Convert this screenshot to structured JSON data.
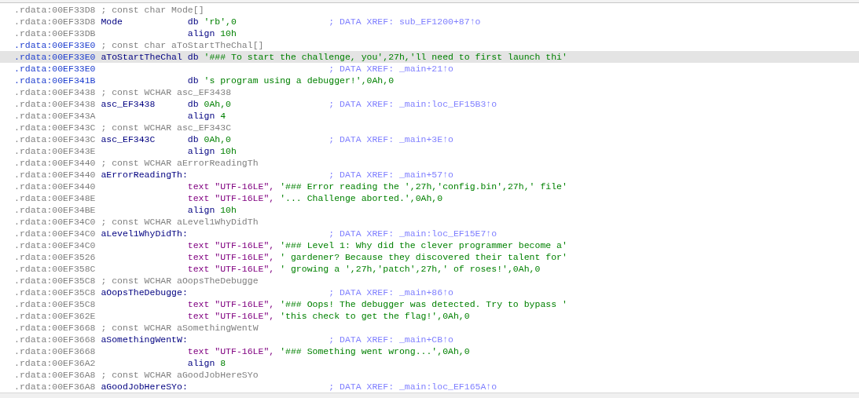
{
  "rows": [
    {
      "kind": "comment",
      "address": ".rdata:00EF33D8",
      "focused": false,
      "selected": false,
      "comment": "; const char Mode[]"
    },
    {
      "kind": "db",
      "address": ".rdata:00EF33D8",
      "focused": false,
      "selected": false,
      "label": "Mode",
      "mnemonic": "db",
      "operands": "'rb',0",
      "xref": "; DATA XREF: sub_EF1200+87↑o"
    },
    {
      "kind": "align",
      "address": ".rdata:00EF33DB",
      "focused": false,
      "selected": false,
      "mnemonic": "align",
      "operands": "10h"
    },
    {
      "kind": "comment",
      "address": ".rdata:00EF33E0",
      "focused": true,
      "selected": false,
      "comment": "; const char aToStartTheChal[]"
    },
    {
      "kind": "db",
      "address": ".rdata:00EF33E0",
      "focused": true,
      "selected": true,
      "label": "aToStartTheChal",
      "mnemonic": "db",
      "operands": "'### To start the challenge, you',27h,'ll need to first launch thi'"
    },
    {
      "kind": "xref",
      "address": ".rdata:00EF33E0",
      "focused": true,
      "selected": false,
      "xref": "; DATA XREF: _main+21↑o"
    },
    {
      "kind": "db",
      "address": ".rdata:00EF341B",
      "focused": true,
      "selected": false,
      "mnemonic": "db",
      "operands": "'s program using a debugger!',0Ah,0"
    },
    {
      "kind": "comment",
      "address": ".rdata:00EF3438",
      "focused": false,
      "selected": false,
      "comment": "; const WCHAR asc_EF3438"
    },
    {
      "kind": "db",
      "address": ".rdata:00EF3438",
      "focused": false,
      "selected": false,
      "label": "asc_EF3438",
      "mnemonic": "db",
      "operands": "0Ah,0",
      "xref": "; DATA XREF: _main:loc_EF15B3↑o"
    },
    {
      "kind": "align",
      "address": ".rdata:00EF343A",
      "focused": false,
      "selected": false,
      "mnemonic": "align",
      "operands": "4"
    },
    {
      "kind": "comment",
      "address": ".rdata:00EF343C",
      "focused": false,
      "selected": false,
      "comment": "; const WCHAR asc_EF343C"
    },
    {
      "kind": "db",
      "address": ".rdata:00EF343C",
      "focused": false,
      "selected": false,
      "label": "asc_EF343C",
      "mnemonic": "db",
      "operands": "0Ah,0",
      "xref": "; DATA XREF: _main+3E↑o"
    },
    {
      "kind": "align",
      "address": ".rdata:00EF343E",
      "focused": false,
      "selected": false,
      "mnemonic": "align",
      "operands": "10h"
    },
    {
      "kind": "comment",
      "address": ".rdata:00EF3440",
      "focused": false,
      "selected": false,
      "comment": "; const WCHAR aErrorReadingTh"
    },
    {
      "kind": "label",
      "address": ".rdata:00EF3440",
      "focused": false,
      "selected": false,
      "label": "aErrorReadingTh:",
      "xref": "; DATA XREF: _main+57↑o"
    },
    {
      "kind": "text",
      "address": ".rdata:00EF3440",
      "focused": false,
      "selected": false,
      "mnemonic": "text",
      "encoding": "\"UTF-16LE\",",
      "operands": "'### Error reading the ',27h,'config.bin',27h,' file'"
    },
    {
      "kind": "text",
      "address": ".rdata:00EF348E",
      "focused": false,
      "selected": false,
      "mnemonic": "text",
      "encoding": "\"UTF-16LE\",",
      "operands": "'... Challenge aborted.',0Ah,0"
    },
    {
      "kind": "align",
      "address": ".rdata:00EF34BE",
      "focused": false,
      "selected": false,
      "mnemonic": "align",
      "operands": "10h"
    },
    {
      "kind": "comment",
      "address": ".rdata:00EF34C0",
      "focused": false,
      "selected": false,
      "comment": "; const WCHAR aLevel1WhyDidTh"
    },
    {
      "kind": "label",
      "address": ".rdata:00EF34C0",
      "focused": false,
      "selected": false,
      "label": "aLevel1WhyDidTh:",
      "xref": "; DATA XREF: _main:loc_EF15E7↑o"
    },
    {
      "kind": "text",
      "address": ".rdata:00EF34C0",
      "focused": false,
      "selected": false,
      "mnemonic": "text",
      "encoding": "\"UTF-16LE\",",
      "operands": "'### Level 1: Why did the clever programmer become a'"
    },
    {
      "kind": "text",
      "address": ".rdata:00EF3526",
      "focused": false,
      "selected": false,
      "mnemonic": "text",
      "encoding": "\"UTF-16LE\",",
      "operands": "' gardener? Because they discovered their talent for'"
    },
    {
      "kind": "text",
      "address": ".rdata:00EF358C",
      "focused": false,
      "selected": false,
      "mnemonic": "text",
      "encoding": "\"UTF-16LE\",",
      "operands": "' growing a ',27h,'patch',27h,' of roses!',0Ah,0"
    },
    {
      "kind": "comment",
      "address": ".rdata:00EF35C8",
      "focused": false,
      "selected": false,
      "comment": "; const WCHAR aOopsTheDebugge"
    },
    {
      "kind": "label",
      "address": ".rdata:00EF35C8",
      "focused": false,
      "selected": false,
      "label": "aOopsTheDebugge:",
      "xref": "; DATA XREF: _main+86↑o"
    },
    {
      "kind": "text",
      "address": ".rdata:00EF35C8",
      "focused": false,
      "selected": false,
      "mnemonic": "text",
      "encoding": "\"UTF-16LE\",",
      "operands": "'### Oops! The debugger was detected. Try to bypass '"
    },
    {
      "kind": "text",
      "address": ".rdata:00EF362E",
      "focused": false,
      "selected": false,
      "mnemonic": "text",
      "encoding": "\"UTF-16LE\",",
      "operands": "'this check to get the flag!',0Ah,0"
    },
    {
      "kind": "comment",
      "address": ".rdata:00EF3668",
      "focused": false,
      "selected": false,
      "comment": "; const WCHAR aSomethingWentW"
    },
    {
      "kind": "label",
      "address": ".rdata:00EF3668",
      "focused": false,
      "selected": false,
      "label": "aSomethingWentW:",
      "xref": "; DATA XREF: _main+CB↑o"
    },
    {
      "kind": "text",
      "address": ".rdata:00EF3668",
      "focused": false,
      "selected": false,
      "mnemonic": "text",
      "encoding": "\"UTF-16LE\",",
      "operands": "'### Something went wrong...',0Ah,0"
    },
    {
      "kind": "align",
      "address": ".rdata:00EF36A2",
      "focused": false,
      "selected": false,
      "mnemonic": "align",
      "operands": "8"
    },
    {
      "kind": "comment",
      "address": ".rdata:00EF36A8",
      "focused": false,
      "selected": false,
      "comment": "; const WCHAR aGoodJobHereSYo"
    },
    {
      "kind": "label",
      "address": ".rdata:00EF36A8",
      "focused": false,
      "selected": false,
      "label": "aGoodJobHereSYo:",
      "xref": "; DATA XREF: _main:loc_EF165A↑o"
    }
  ]
}
